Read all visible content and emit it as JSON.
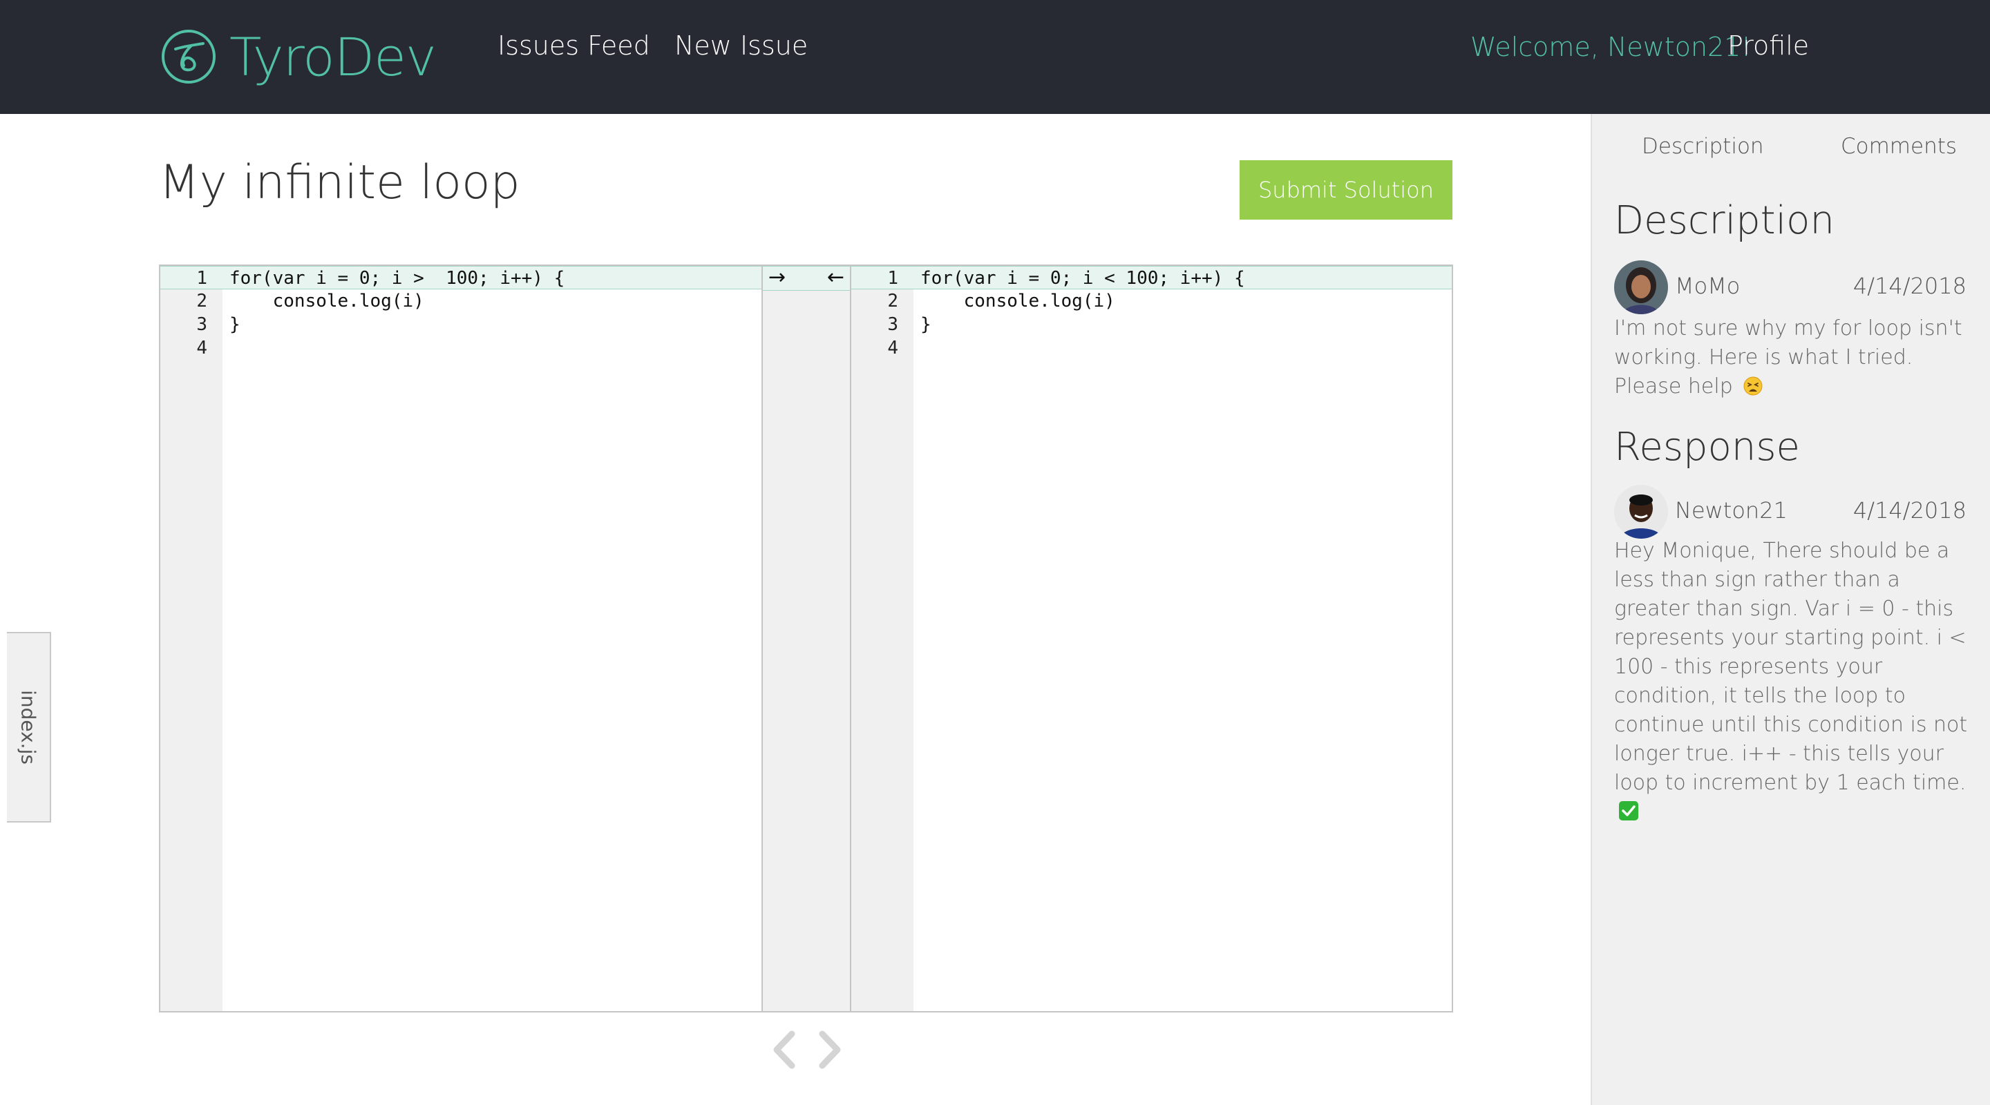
{
  "navbar": {
    "brand": "TyroDev",
    "links": {
      "issues_feed": "Issues Feed",
      "new_issue": "New Issue",
      "profile": "Profile"
    },
    "welcome": "Welcome, Newton21!"
  },
  "main": {
    "title": "My infinite loop",
    "submit_label": "Submit Solution",
    "file_tab": "index.js",
    "editor": {
      "left": {
        "lines": [
          {
            "no": "1",
            "code": "for(var i = 0; i >  100; i++) {"
          },
          {
            "no": "2",
            "code": "    console.log(i)"
          },
          {
            "no": "3",
            "code": "}"
          },
          {
            "no": "4",
            "code": ""
          }
        ]
      },
      "right": {
        "lines": [
          {
            "no": "1",
            "code": "for(var i = 0; i < 100; i++) {"
          },
          {
            "no": "2",
            "code": "    console.log(i)"
          },
          {
            "no": "3",
            "code": "}"
          },
          {
            "no": "4",
            "code": ""
          }
        ]
      },
      "merge_arrows": {
        "to_right": "→",
        "to_left": "←"
      }
    }
  },
  "sidebar": {
    "tabs": {
      "description": "Description",
      "comments": "Comments"
    },
    "description": {
      "heading": "Description",
      "author": "MoMo",
      "date": "4/14/2018",
      "body": "I'm not sure why my for loop isn't working. Here is what I tried. Please help"
    },
    "response": {
      "heading": "Response",
      "author": "Newton21",
      "date": "4/14/2018",
      "body": "Hey Monique, There should be a less than sign rather than a greater than sign. Var i = 0 - this represents your starting point. i < 100 - this represents your condition, it tells the loop to continue until this condition is not longer true. i++ - this tells your loop to increment by 1 each time."
    }
  },
  "colors": {
    "navbar_bg": "#272a33",
    "brand_accent": "#52c0a5",
    "submit_green": "#96cd4b",
    "sidebar_bg": "#f0f0f0"
  }
}
